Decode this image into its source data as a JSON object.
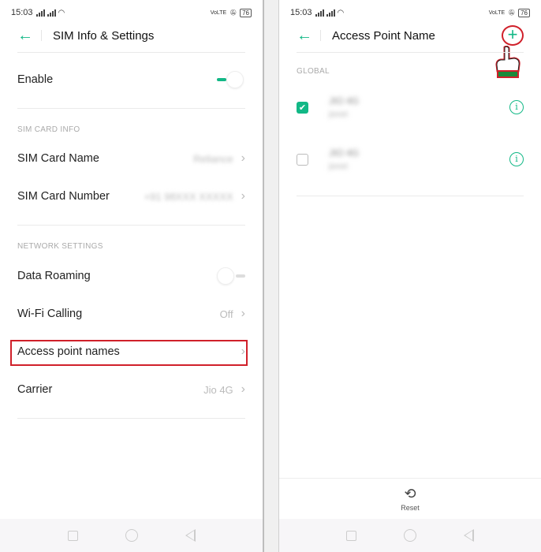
{
  "status_bar": {
    "time": "15:03",
    "battery": "76",
    "volte": "VoLTE"
  },
  "left": {
    "title": "SIM Info & Settings",
    "enable": {
      "label": "Enable",
      "on": true
    },
    "sim_card_info_header": "SIM CARD INFO",
    "sim_card_name": {
      "label": "SIM Card Name",
      "value": "Reliance"
    },
    "sim_card_number": {
      "label": "SIM Card Number",
      "value": "+91 98XXX XXXXX"
    },
    "network_settings_header": "NETWORK SETTINGS",
    "data_roaming": {
      "label": "Data Roaming",
      "on": false
    },
    "wifi_calling": {
      "label": "Wi-Fi Calling",
      "value": "Off"
    },
    "access_point_names": {
      "label": "Access point names"
    },
    "carrier": {
      "label": "Carrier",
      "value": "Jio 4G"
    }
  },
  "right": {
    "title": "Access Point Name",
    "add_icon": "+",
    "section": "GLOBAL",
    "apns": [
      {
        "name": "JIO 4G",
        "sub": "jionet",
        "selected": true
      },
      {
        "name": "JIO 4G",
        "sub": "jionet",
        "selected": false
      }
    ],
    "reset_label": "Reset"
  },
  "colors": {
    "accent": "#12b886",
    "highlight": "#d0202a"
  }
}
